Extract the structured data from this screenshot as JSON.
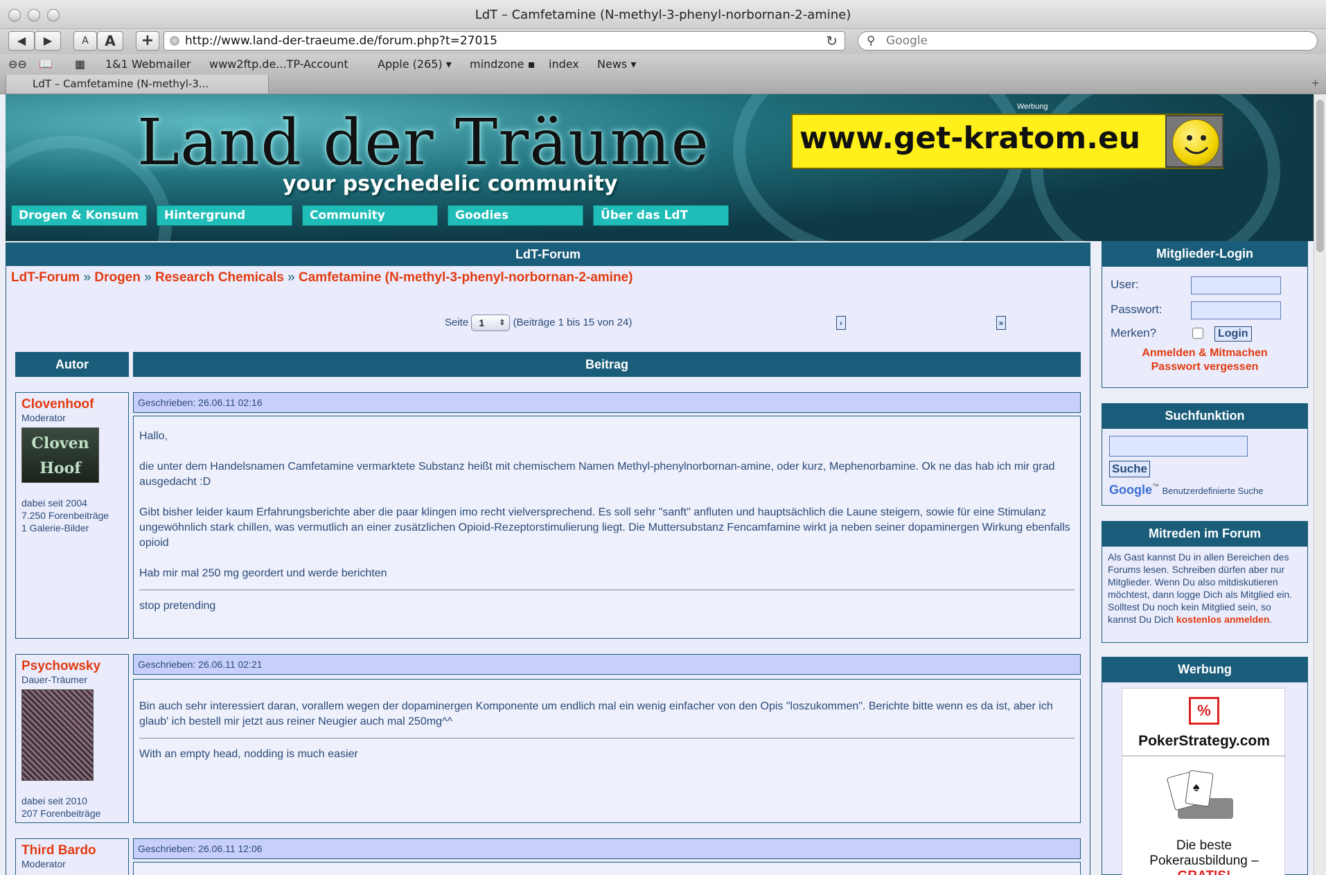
{
  "window": {
    "title": "LdT – Camfetamine (N-methyl-3-phenyl-norbornan-2-amine)"
  },
  "toolbar": {
    "back": "◀",
    "forward": "▶",
    "font_small": "A",
    "font_large": "A",
    "add": "+",
    "url": "http://www.land-der-traeume.de/forum.php?t=27015",
    "reload": "↻",
    "search_placeholder": "Google"
  },
  "bookmarks": [
    "1&1 Webmailer",
    "www2ftp.de...TP-Account",
    "Apple (265) ▾",
    "mindzone ▪",
    "index",
    "News ▾"
  ],
  "tabs": [
    {
      "label": "LdT – Camfetamine (N-methyl-3..."
    }
  ],
  "banner": {
    "logo": "Land der Träume",
    "tagline": "your psychedelic community",
    "werbung": "Werbung",
    "ad_text": "www.get-kratom.eu"
  },
  "nav": [
    "Drogen & Konsum",
    "Hintergrund",
    "Community",
    "Goodies",
    "Über das LdT"
  ],
  "forum": {
    "header": "LdT-Forum",
    "breadcrumb": [
      "LdT-Forum",
      "Drogen",
      "Research Chemicals",
      "Camfetamine (N-methyl-3-phenyl-norbornan-2-amine)"
    ],
    "breadcrumb_sep": "»",
    "pager": {
      "label": "Seite",
      "current": "1",
      "info": "(Beiträge 1 bis 15 von 24)",
      "next": "›",
      "last": "»"
    },
    "columns": {
      "author": "Autor",
      "post": "Beitrag"
    },
    "posts": [
      {
        "author": "Clovenhoof",
        "rank": "Moderator",
        "avatar_text": "Cloven Hoof",
        "since": "dabei seit 2004",
        "posts": "7.250 Forenbeiträge",
        "gallery": "1 Galerie-Bilder",
        "meta": "Geschrieben: 26.06.11 02:16",
        "p1": "Hallo,",
        "p2": "die unter dem Handelsnamen Camfetamine vermarktete Substanz heißt mit chemischem Namen Methyl-phenylnorbornan-amine, oder kurz, Mephenorbamine. Ok ne das hab ich mir grad ausgedacht :D",
        "p3": "Gibt bisher leider kaum Erfahrungsberichte aber die paar klingen imo recht vielversprechend. Es soll sehr \"sanft\" anfluten und hauptsächlich die Laune steigern, sowie für eine Stimulanz ungewöhnlich stark chillen, was vermutlich an einer zusätzlichen Opioid-Rezeptorstimulierung liegt. Die Muttersubstanz Fencamfamine wirkt ja neben seiner dopaminergen Wirkung ebenfalls opioid",
        "p4": "Hab mir mal 250 mg geordert und werde berichten",
        "signature": "stop pretending"
      },
      {
        "author": "Psychowsky",
        "rank": "Dauer-Träumer",
        "since": "dabei seit 2010",
        "posts": "207 Forenbeiträge",
        "meta": "Geschrieben: 26.06.11 02:21",
        "p1": "Bin auch sehr interessiert daran, vorallem wegen der dopaminergen Komponente um endlich mal ein wenig einfacher von den Opis \"loszukommen\". Berichte bitte wenn es da ist, aber ich glaub' ich bestell mir jetzt aus reiner Neugier auch mal 250mg^^",
        "signature": "With an empty head, nodding is much easier"
      },
      {
        "author": "Third Bardo",
        "rank": "Moderator",
        "meta": "Geschrieben: 26.06.11 12:06"
      }
    ]
  },
  "sidebar": {
    "login": {
      "title": "Mitglieder-Login",
      "user": "User:",
      "password": "Passwort:",
      "remember": "Merken?",
      "button": "Login",
      "register": "Anmelden & Mitmachen",
      "forgot": "Passwort vergessen"
    },
    "search": {
      "title": "Suchfunktion",
      "button": "Suche",
      "google": "Google",
      "tm": "™",
      "custom": "Benutzerdefinierte Suche"
    },
    "mitreden": {
      "title": "Mitreden im Forum",
      "text": "Als Gast kannst Du in allen Bereichen des Forums lesen. Schreiben dürfen aber nur Mitglieder. Wenn Du also mitdiskutieren möchtest, dann logge Dich als Mitglied ein. Solltest Du noch kein Mitglied sein, so kannst Du Dich",
      "link": "kostenlos anmelden",
      "end": "."
    },
    "werbung": {
      "title": "Werbung",
      "brand": "PokerStrategy.com",
      "line1": "Die beste",
      "line2": "Pokerausbildung –",
      "line3": "GRATIS!"
    }
  },
  "colors": {
    "header_blue": "#1a5d7a",
    "link_red": "#e23a10",
    "nav_teal": "#20bdb8",
    "ad_yellow": "#ffef1a"
  }
}
